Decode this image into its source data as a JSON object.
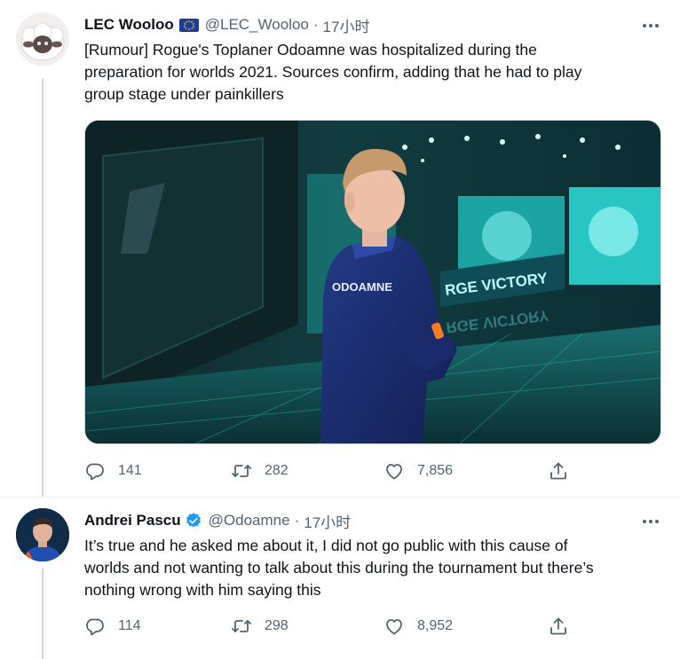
{
  "tweets": [
    {
      "author_name": "LEC Wooloo",
      "handle": "@LEC_Wooloo",
      "separator": "·",
      "time": "17小时",
      "text_lines": [
        "[Rumour] Rogue's Toplaner Odoamne was hospitalized during the",
        "preparation for worlds 2021. Sources confirm, adding that he had to play",
        "group stage under painkillers"
      ],
      "image": {
        "jersey_name": "ODOAMNE",
        "banner_text": "RGE VICTORY",
        "banner_reflection": "RGE VICTORY"
      },
      "replies": "141",
      "retweets": "282",
      "likes": "7,856",
      "icons": [
        "eu-flag-icon",
        "more-icon",
        "reply-icon",
        "retweet-icon",
        "like-icon",
        "share-icon"
      ]
    },
    {
      "author_name": "Andrei Pascu",
      "handle": "@Odoamne",
      "separator": "·",
      "time": "17小时",
      "text_lines": [
        "It’s true and he asked me about it, I did not go public with this cause of",
        "worlds and not wanting to talk about this during the tournament but there’s",
        "nothing wrong with him saying this"
      ],
      "replies": "114",
      "retweets": "298",
      "likes": "8,952",
      "icons": [
        "verified-icon",
        "more-icon",
        "reply-icon",
        "retweet-icon",
        "like-icon",
        "share-icon"
      ]
    }
  ],
  "colors": {
    "text": "#0f1419",
    "secondary": "#536471",
    "verified": "#1d9bf0",
    "thread_line": "#cfd9de",
    "accent_teal": "#19c2c0"
  }
}
